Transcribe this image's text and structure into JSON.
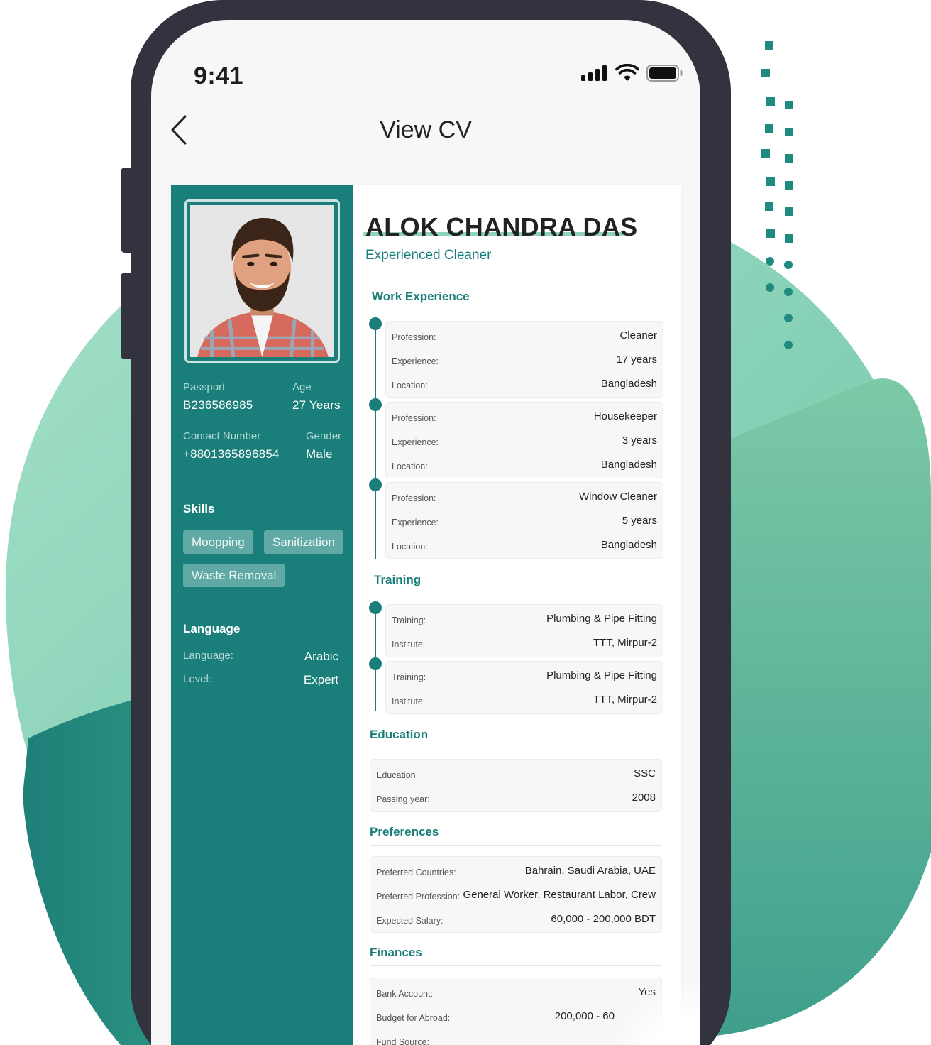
{
  "status_bar": {
    "time": "9:41"
  },
  "header": {
    "title": "View CV"
  },
  "profile": {
    "name": "ALOK CHANDRA DAS",
    "role": "Experienced Cleaner",
    "passport_label": "Passport",
    "passport": "B236586985",
    "age_label": "Age",
    "age": "27 Years",
    "contact_label": "Contact Number",
    "contact": "+8801365896854",
    "gender_label": "Gender",
    "gender": "Male"
  },
  "skills": {
    "heading": "Skills",
    "items": [
      "Moopping",
      "Sanitization",
      "Waste Removal"
    ]
  },
  "language": {
    "heading": "Language",
    "language_label": "Language:",
    "language": "Arabic",
    "level_label": "Level:",
    "level": "Expert"
  },
  "work_experience": {
    "heading": "Work Experience",
    "labels": {
      "profession": "Profession:",
      "experience": "Experience:",
      "location": "Location:"
    },
    "items": [
      {
        "profession": "Cleaner",
        "experience": "17 years",
        "location": "Bangladesh"
      },
      {
        "profession": "Housekeeper",
        "experience": "3 years",
        "location": "Bangladesh"
      },
      {
        "profession": "Window Cleaner",
        "experience": "5 years",
        "location": "Bangladesh"
      }
    ]
  },
  "training": {
    "heading": "Training",
    "labels": {
      "training": "Training:",
      "institute": "Institute:"
    },
    "items": [
      {
        "training": "Plumbing & Pipe Fitting",
        "institute": "TTT, Mirpur-2"
      },
      {
        "training": "Plumbing & Pipe Fitting",
        "institute": "TTT, Mirpur-2"
      }
    ]
  },
  "education": {
    "heading": "Education",
    "education_label": "Education",
    "education": "SSC",
    "year_label": "Passing year:",
    "year": "2008"
  },
  "preferences": {
    "heading": "Preferences",
    "countries_label": "Preferred Countries:",
    "countries": "Bahrain, Saudi Arabia, UAE",
    "profession_label": "Preferred Profession:",
    "profession": "General Worker, Restaurant Labor, Crew",
    "salary_label": "Expected Salary:",
    "salary": "60,000 - 200,000 BDT"
  },
  "finances": {
    "heading": "Finances",
    "bank_label": "Bank Account:",
    "bank": "Yes",
    "budget_label": "Budget for Abroad:",
    "budget": "200,000 - 60",
    "fund_label": "Fund Source:"
  },
  "colors": {
    "primary": "#1a7f7a",
    "chip": "#60a9a4",
    "blob_light": "#8fd3bb",
    "blob_dark": "#1e827a",
    "phone_frame": "#33323f"
  }
}
